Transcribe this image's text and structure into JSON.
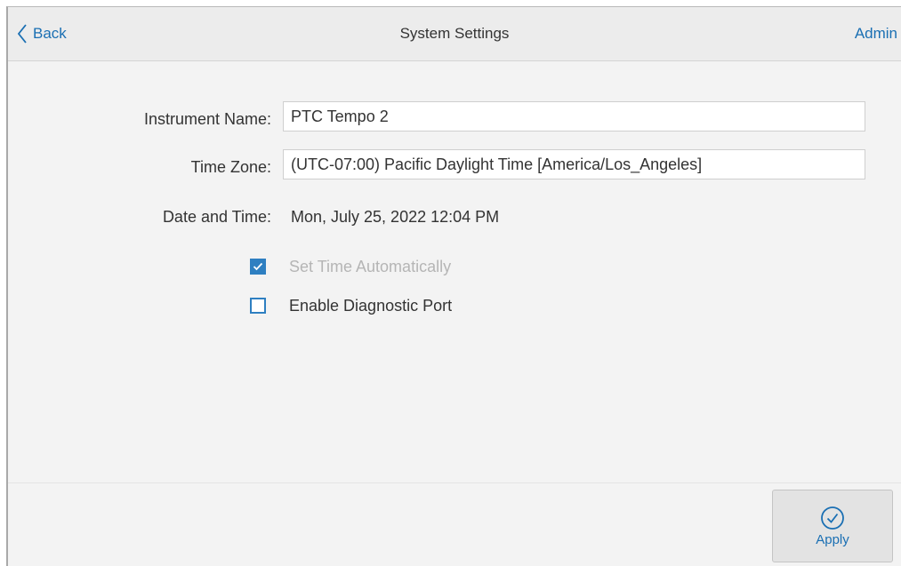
{
  "header": {
    "back_label": "Back",
    "title": "System Settings",
    "user_label": "Admin"
  },
  "form": {
    "instrument_name": {
      "label": "Instrument Name:",
      "value": "PTC Tempo 2"
    },
    "time_zone": {
      "label": "Time Zone:",
      "value": "(UTC-07:00) Pacific Daylight Time [America/Los_Angeles]"
    },
    "date_time": {
      "label": "Date and Time:",
      "value": "Mon, July 25, 2022 12:04 PM"
    },
    "checkboxes": [
      {
        "label": "Set Time Automatically",
        "checked": true,
        "disabled": true
      },
      {
        "label": "Enable Diagnostic Port",
        "checked": false,
        "disabled": false
      }
    ]
  },
  "footer": {
    "apply_label": "Apply"
  },
  "colors": {
    "accent": "#1a6fb3",
    "checkbox": "#2e7fc1",
    "background": "#f3f3f3"
  },
  "icons": {
    "back": "chevron-left-icon",
    "apply": "check-circle-icon",
    "checkmark": "checkmark-icon"
  }
}
